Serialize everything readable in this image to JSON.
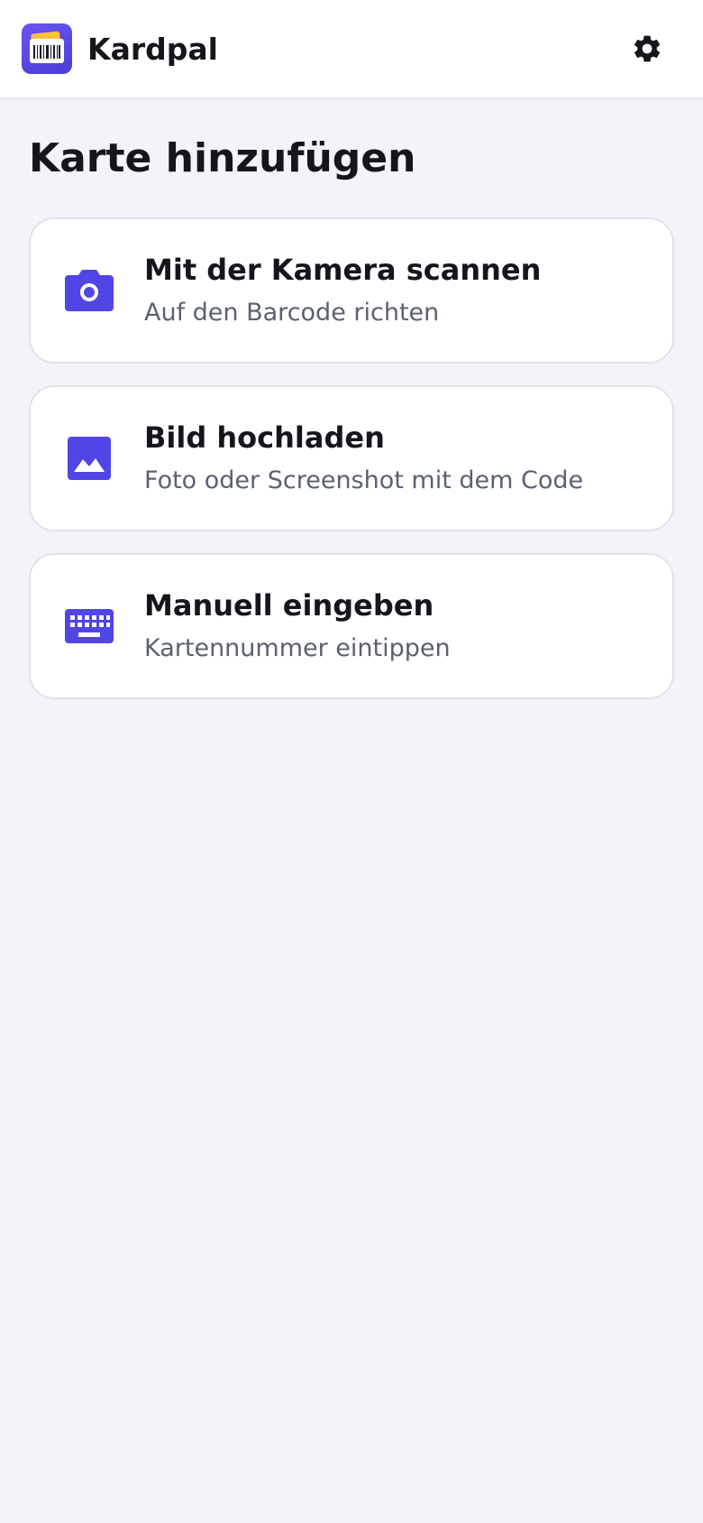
{
  "app": {
    "title": "Kardpal",
    "accent_color": "#4f46e5",
    "logo_icon": "barcode-card-icon"
  },
  "header": {
    "settings_icon": "gear-icon"
  },
  "page": {
    "title": "Karte hinzufügen"
  },
  "options": [
    {
      "icon": "camera-icon",
      "title": "Mit der Kamera scannen",
      "subtitle": "Auf den Barcode richten"
    },
    {
      "icon": "image-icon",
      "title": "Bild hochladen",
      "subtitle": "Foto oder Screenshot mit dem Code"
    },
    {
      "icon": "keyboard-icon",
      "title": "Manuell eingeben",
      "subtitle": "Kartennummer eintippen"
    }
  ]
}
